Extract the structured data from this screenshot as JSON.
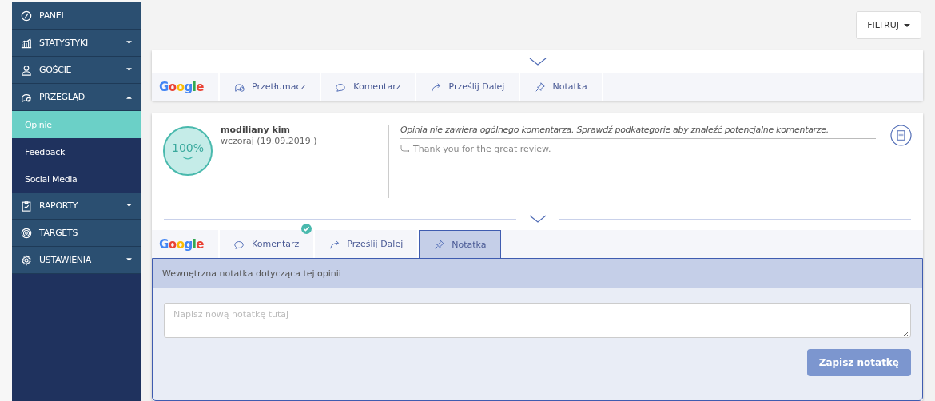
{
  "sidebar": {
    "items": [
      {
        "label": "PANEL",
        "kind": "compass"
      },
      {
        "label": "STATYSTYKI",
        "kind": "chart",
        "expanded": false
      },
      {
        "label": "GOŚCIE",
        "kind": "person",
        "expanded": false
      },
      {
        "label": "PRZEGLĄD",
        "kind": "chat",
        "expanded": true,
        "children": [
          {
            "label": "Opinie",
            "selected": true
          },
          {
            "label": "Feedback",
            "selected": false
          },
          {
            "label": "Social Media",
            "selected": false
          }
        ]
      },
      {
        "label": "RAPORTY",
        "kind": "clipboard",
        "expanded": false
      },
      {
        "label": "TARGETS",
        "kind": "target"
      },
      {
        "label": "USTAWIENIA",
        "kind": "gear",
        "expanded": false
      }
    ]
  },
  "header": {
    "filter_button": "FILTRUJ"
  },
  "reviews": [
    {
      "source": "Google",
      "actions": [
        {
          "label": "Przetłumacz",
          "kind": "translate",
          "selected": false,
          "done": false
        },
        {
          "label": "Komentarz",
          "kind": "comment",
          "selected": false,
          "done": false
        },
        {
          "label": "Prześlij Dalej",
          "kind": "forward",
          "selected": false,
          "done": false
        },
        {
          "label": "Notatka",
          "kind": "pin",
          "selected": false,
          "done": false
        }
      ]
    },
    {
      "author": "modiliany kim",
      "date": "wczoraj (19.09.2019 )",
      "score": "100%",
      "comment": "Opinia nie zawiera ogólnego komentarza. Sprawdź podkategorie aby znaleźć potencjalne komentarze.",
      "reply": "Thank you for the great review.",
      "source": "Google",
      "actions": [
        {
          "label": "Komentarz",
          "kind": "comment",
          "selected": false,
          "done": true
        },
        {
          "label": "Prześlij Dalej",
          "kind": "forward",
          "selected": false,
          "done": false
        },
        {
          "label": "Notatka",
          "kind": "pin",
          "selected": true,
          "done": false
        }
      ],
      "note": {
        "title": "Wewnętrzna notatka dotycząca tej opinii",
        "placeholder": "Napisz nową notatkę tutaj",
        "save_button": "Zapisz notatkę"
      }
    }
  ]
}
